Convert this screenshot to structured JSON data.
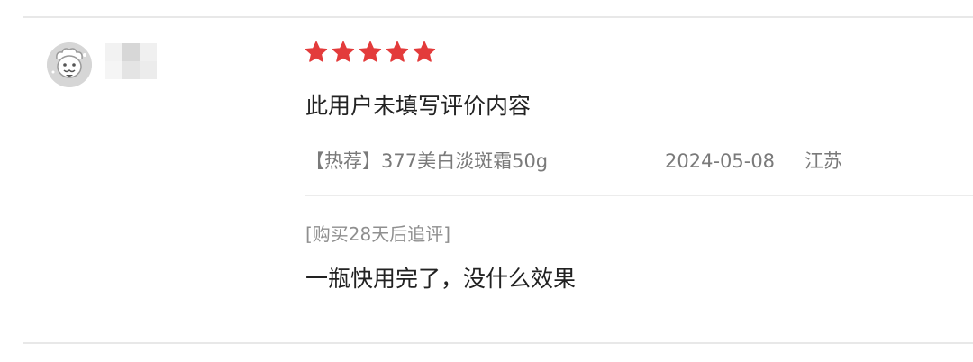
{
  "review": {
    "avatar_icon": "cartoon-avatar-icon",
    "username_obscured": true,
    "rating": {
      "value": 5,
      "max": 5,
      "color": "#e33b3b",
      "icon": "star-icon"
    },
    "content": "此用户未填写评价内容",
    "product": "【热荐】377美白淡斑霜50g",
    "date": "2024-05-08",
    "location": "江苏"
  },
  "followup": {
    "label": "[购买28天后追评]",
    "content": "一瓶快用完了，没什么效果"
  }
}
